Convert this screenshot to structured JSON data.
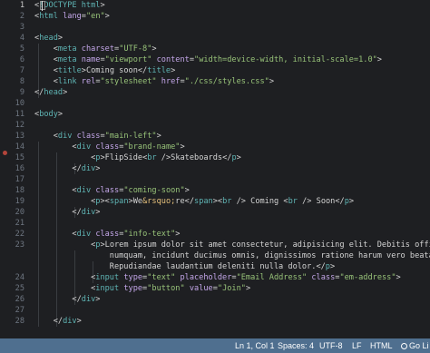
{
  "editor": {
    "lines": [
      {
        "n": "1",
        "parts": [
          [
            "t-br",
            "<"
          ],
          [
            "t-tag",
            "!DOCTYPE html"
          ],
          [
            "t-br",
            ">"
          ]
        ]
      },
      {
        "n": "2",
        "parts": [
          [
            "t-br",
            "<"
          ],
          [
            "t-tag",
            "html"
          ],
          [
            "t-text",
            " "
          ],
          [
            "t-attr",
            "lang"
          ],
          [
            "t-br",
            "="
          ],
          [
            "t-str",
            "\"en\""
          ],
          [
            "t-br",
            ">"
          ]
        ]
      },
      {
        "n": "3",
        "parts": []
      },
      {
        "n": "4",
        "parts": [
          [
            "t-br",
            "<"
          ],
          [
            "t-tag",
            "head"
          ],
          [
            "t-br",
            ">"
          ]
        ]
      },
      {
        "n": "5",
        "parts": [
          [
            "t-text",
            "    "
          ],
          [
            "t-br",
            "<"
          ],
          [
            "t-tag",
            "meta"
          ],
          [
            "t-text",
            " "
          ],
          [
            "t-attr",
            "charset"
          ],
          [
            "t-br",
            "="
          ],
          [
            "t-str",
            "\"UTF-8\""
          ],
          [
            "t-br",
            ">"
          ]
        ]
      },
      {
        "n": "6",
        "parts": [
          [
            "t-text",
            "    "
          ],
          [
            "t-br",
            "<"
          ],
          [
            "t-tag",
            "meta"
          ],
          [
            "t-text",
            " "
          ],
          [
            "t-attr",
            "name"
          ],
          [
            "t-br",
            "="
          ],
          [
            "t-str",
            "\"viewport\""
          ],
          [
            "t-text",
            " "
          ],
          [
            "t-attr",
            "content"
          ],
          [
            "t-br",
            "="
          ],
          [
            "t-str",
            "\"width=device-width, initial-scale=1.0\""
          ],
          [
            "t-br",
            ">"
          ]
        ]
      },
      {
        "n": "7",
        "parts": [
          [
            "t-text",
            "    "
          ],
          [
            "t-br",
            "<"
          ],
          [
            "t-tag",
            "title"
          ],
          [
            "t-br",
            ">"
          ],
          [
            "t-text",
            "Coming soon"
          ],
          [
            "t-br",
            "</"
          ],
          [
            "t-tag",
            "title"
          ],
          [
            "t-br",
            ">"
          ]
        ]
      },
      {
        "n": "8",
        "parts": [
          [
            "t-text",
            "    "
          ],
          [
            "t-br",
            "<"
          ],
          [
            "t-tag",
            "link"
          ],
          [
            "t-text",
            " "
          ],
          [
            "t-attr",
            "rel"
          ],
          [
            "t-br",
            "="
          ],
          [
            "t-str",
            "\"stylesheet\""
          ],
          [
            "t-text",
            " "
          ],
          [
            "t-attr",
            "href"
          ],
          [
            "t-br",
            "="
          ],
          [
            "t-str",
            "\"./css/styles.css\""
          ],
          [
            "t-br",
            ">"
          ]
        ]
      },
      {
        "n": "9",
        "parts": [
          [
            "t-br",
            "</"
          ],
          [
            "t-tag",
            "head"
          ],
          [
            "t-br",
            ">"
          ]
        ]
      },
      {
        "n": "10",
        "parts": []
      },
      {
        "n": "11",
        "parts": [
          [
            "t-br",
            "<"
          ],
          [
            "t-tag",
            "body"
          ],
          [
            "t-br",
            ">"
          ]
        ]
      },
      {
        "n": "12",
        "parts": []
      },
      {
        "n": "13",
        "parts": [
          [
            "t-text",
            "    "
          ],
          [
            "t-br",
            "<"
          ],
          [
            "t-tag",
            "div"
          ],
          [
            "t-text",
            " "
          ],
          [
            "t-attr",
            "class"
          ],
          [
            "t-br",
            "="
          ],
          [
            "t-str",
            "\"main-left\""
          ],
          [
            "t-br",
            ">"
          ]
        ]
      },
      {
        "n": "14",
        "parts": [
          [
            "t-text",
            "        "
          ],
          [
            "t-br",
            "<"
          ],
          [
            "t-tag",
            "div"
          ],
          [
            "t-text",
            " "
          ],
          [
            "t-attr",
            "class"
          ],
          [
            "t-br",
            "="
          ],
          [
            "t-str",
            "\"brand-name\""
          ],
          [
            "t-br",
            ">"
          ]
        ]
      },
      {
        "n": "15",
        "parts": [
          [
            "t-text",
            "            "
          ],
          [
            "t-br",
            "<"
          ],
          [
            "t-tag",
            "p"
          ],
          [
            "t-br",
            ">"
          ],
          [
            "t-text",
            "FlipSide"
          ],
          [
            "t-br",
            "<"
          ],
          [
            "t-tag",
            "br"
          ],
          [
            "t-text",
            " "
          ],
          [
            "t-br",
            "/>"
          ],
          [
            "t-text",
            "Skateboards"
          ],
          [
            "t-br",
            "</"
          ],
          [
            "t-tag",
            "p"
          ],
          [
            "t-br",
            ">"
          ]
        ]
      },
      {
        "n": "16",
        "parts": [
          [
            "t-text",
            "        "
          ],
          [
            "t-br",
            "</"
          ],
          [
            "t-tag",
            "div"
          ],
          [
            "t-br",
            ">"
          ]
        ]
      },
      {
        "n": "17",
        "parts": []
      },
      {
        "n": "18",
        "parts": [
          [
            "t-text",
            "        "
          ],
          [
            "t-br",
            "<"
          ],
          [
            "t-tag",
            "div"
          ],
          [
            "t-text",
            " "
          ],
          [
            "t-attr",
            "class"
          ],
          [
            "t-br",
            "="
          ],
          [
            "t-str",
            "\"coming-soon\""
          ],
          [
            "t-br",
            ">"
          ]
        ]
      },
      {
        "n": "19",
        "parts": [
          [
            "t-text",
            "            "
          ],
          [
            "t-br",
            "<"
          ],
          [
            "t-tag",
            "p"
          ],
          [
            "t-br",
            "><"
          ],
          [
            "t-tag",
            "span"
          ],
          [
            "t-br",
            ">"
          ],
          [
            "t-text",
            "We"
          ],
          [
            "t-ent",
            "&rsquo;"
          ],
          [
            "t-text",
            "re"
          ],
          [
            "t-br",
            "</"
          ],
          [
            "t-tag",
            "span"
          ],
          [
            "t-br",
            "><"
          ],
          [
            "t-tag",
            "br"
          ],
          [
            "t-text",
            " "
          ],
          [
            "t-br",
            "/>"
          ],
          [
            "t-text",
            " Coming "
          ],
          [
            "t-br",
            "<"
          ],
          [
            "t-tag",
            "br"
          ],
          [
            "t-text",
            " "
          ],
          [
            "t-br",
            "/>"
          ],
          [
            "t-text",
            " Soon"
          ],
          [
            "t-br",
            "</"
          ],
          [
            "t-tag",
            "p"
          ],
          [
            "t-br",
            ">"
          ]
        ]
      },
      {
        "n": "20",
        "parts": [
          [
            "t-text",
            "        "
          ],
          [
            "t-br",
            "</"
          ],
          [
            "t-tag",
            "div"
          ],
          [
            "t-br",
            ">"
          ]
        ]
      },
      {
        "n": "21",
        "parts": []
      },
      {
        "n": "22",
        "parts": [
          [
            "t-text",
            "        "
          ],
          [
            "t-br",
            "<"
          ],
          [
            "t-tag",
            "div"
          ],
          [
            "t-text",
            " "
          ],
          [
            "t-attr",
            "class"
          ],
          [
            "t-br",
            "="
          ],
          [
            "t-str",
            "\"info-text\""
          ],
          [
            "t-br",
            ">"
          ]
        ]
      },
      {
        "n": "23",
        "parts": [
          [
            "t-text",
            "            "
          ],
          [
            "t-br",
            "<"
          ],
          [
            "t-tag",
            "p"
          ],
          [
            "t-br",
            ">"
          ],
          [
            "t-text",
            "Lorem ipsum dolor sit amet consectetur, adipisicing elit. Debitis officia"
          ]
        ]
      },
      {
        "n": "",
        "parts": [
          [
            "t-text",
            "                numquam, incidunt ducimus omnis, dignissimos ratione harum vero beatae"
          ]
        ]
      },
      {
        "n": "",
        "parts": [
          [
            "t-text",
            "                Repudiandae laudantium deleniti nulla dolor."
          ],
          [
            "t-br",
            "</"
          ],
          [
            "t-tag",
            "p"
          ],
          [
            "t-br",
            ">"
          ]
        ]
      },
      {
        "n": "24",
        "parts": [
          [
            "t-text",
            "            "
          ],
          [
            "t-br",
            "<"
          ],
          [
            "t-tag",
            "input"
          ],
          [
            "t-text",
            " "
          ],
          [
            "t-attr",
            "type"
          ],
          [
            "t-br",
            "="
          ],
          [
            "t-str",
            "\"text\""
          ],
          [
            "t-text",
            " "
          ],
          [
            "t-attr",
            "placeholder"
          ],
          [
            "t-br",
            "="
          ],
          [
            "t-str",
            "\"Email Address\""
          ],
          [
            "t-text",
            " "
          ],
          [
            "t-attr",
            "class"
          ],
          [
            "t-br",
            "="
          ],
          [
            "t-str",
            "\"em-address\""
          ],
          [
            "t-br",
            ">"
          ]
        ]
      },
      {
        "n": "25",
        "parts": [
          [
            "t-text",
            "            "
          ],
          [
            "t-br",
            "<"
          ],
          [
            "t-tag",
            "input"
          ],
          [
            "t-text",
            " "
          ],
          [
            "t-attr",
            "type"
          ],
          [
            "t-br",
            "="
          ],
          [
            "t-str",
            "\"button\""
          ],
          [
            "t-text",
            " "
          ],
          [
            "t-attr",
            "value"
          ],
          [
            "t-br",
            "="
          ],
          [
            "t-str",
            "\"Join\""
          ],
          [
            "t-br",
            ">"
          ]
        ]
      },
      {
        "n": "26",
        "parts": [
          [
            "t-text",
            "        "
          ],
          [
            "t-br",
            "</"
          ],
          [
            "t-tag",
            "div"
          ],
          [
            "t-br",
            ">"
          ]
        ]
      },
      {
        "n": "27",
        "parts": []
      },
      {
        "n": "28",
        "parts": [
          [
            "t-text",
            "    "
          ],
          [
            "t-br",
            "</"
          ],
          [
            "t-tag",
            "div"
          ],
          [
            "t-br",
            ">"
          ]
        ]
      }
    ]
  },
  "statusbar": {
    "cursor_position": "Ln 1, Col 1",
    "indentation": "Spaces: 4",
    "encoding": "UTF-8",
    "line_ending": "LF",
    "language": "HTML",
    "golive": "Go Li"
  },
  "colors": {
    "background": "#1e1f22",
    "statusbar": "#4f6f8f",
    "tag": "#5fb4b4",
    "attribute": "#c3a6e8",
    "string": "#98c379",
    "entity": "#e5c07b",
    "breakpoint": "#b4453b"
  }
}
